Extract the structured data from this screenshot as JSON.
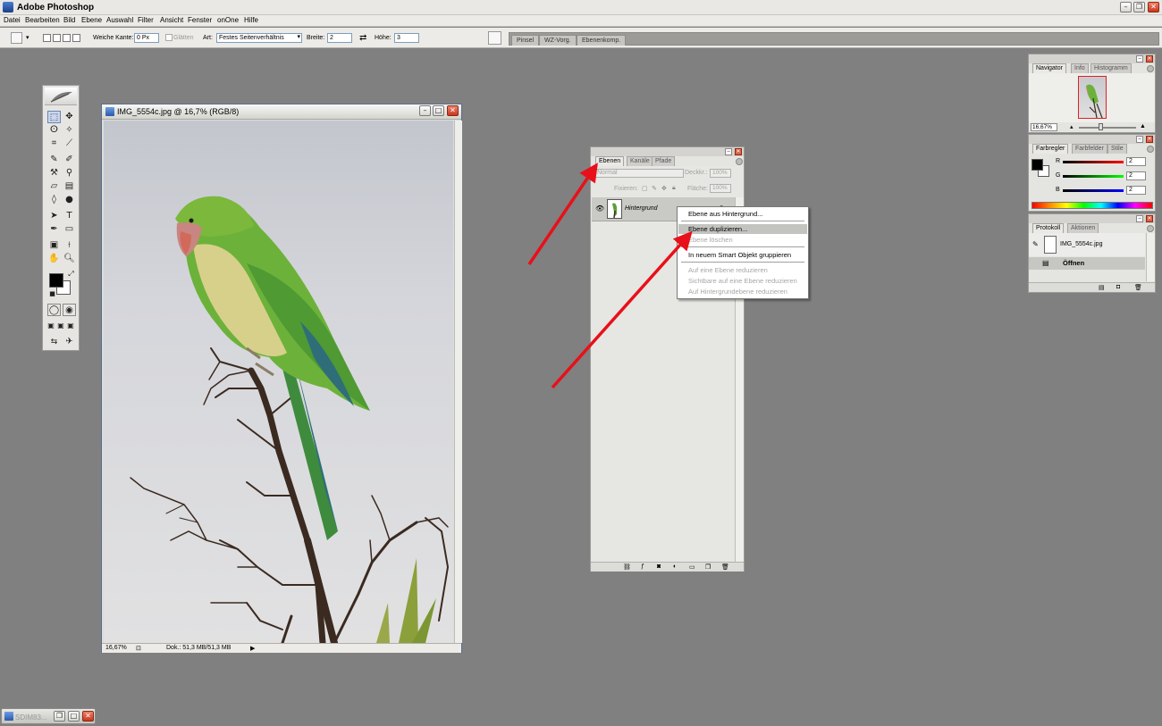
{
  "app": {
    "title": "Adobe Photoshop"
  },
  "menu": [
    "Datei",
    "Bearbeiten",
    "Bild",
    "Ebene",
    "Auswahl",
    "Filter",
    "Ansicht",
    "Fenster",
    "onOne",
    "Hilfe"
  ],
  "options": {
    "weiche_kante_label": "Weiche Kante:",
    "weiche_kante_value": "0 Px",
    "glaetten_label": "Glätten",
    "art_label": "Art:",
    "art_value": "Festes Seitenverhältnis",
    "breite_label": "Breite:",
    "breite_value": "2",
    "hoehe_label": "Höhe:",
    "hoehe_value": "3"
  },
  "well_tabs": [
    "Pinsel",
    "WZ-Vorg.",
    "Ebenenkomp."
  ],
  "document": {
    "title": "IMG_5554c.jpg @ 16,7% (RGB/8)",
    "zoom": "16,67%",
    "doc_size": "Dok.: 51,3 MB/51,3 MB"
  },
  "layers_palette": {
    "tabs": [
      "Ebenen",
      "Kanäle",
      "Pfade"
    ],
    "blend_mode": "Normal",
    "opacity_label": "Deckkr.:",
    "opacity_value": "100%",
    "lock_label": "Fixieren:",
    "fill_label": "Fläche:",
    "fill_value": "100%",
    "layer_name": "Hintergrund"
  },
  "context_menu": {
    "items": [
      {
        "label": "Ebene aus Hintergrund...",
        "enabled": true
      },
      {
        "label": "Ebene duplizieren...",
        "enabled": true,
        "highlighted": true
      },
      {
        "label": "Ebene löschen",
        "enabled": false
      },
      {
        "label": "In neuem Smart Objekt gruppieren",
        "enabled": true
      },
      {
        "label": "Auf eine Ebene reduzieren",
        "enabled": false
      },
      {
        "label": "Sichtbare auf eine Ebene reduzieren",
        "enabled": false
      },
      {
        "label": "Auf Hintergrundebene reduzieren",
        "enabled": false
      }
    ]
  },
  "navigator_palette": {
    "tabs": [
      "Navigator",
      "Info",
      "Histogramm"
    ],
    "zoom": "16,67%"
  },
  "color_palette": {
    "tabs": [
      "Farbregler",
      "Farbfelder",
      "Stile"
    ],
    "r_label": "R",
    "r_value": "2",
    "g_label": "G",
    "g_value": "2",
    "b_label": "B",
    "b_value": "2"
  },
  "history_palette": {
    "tabs": [
      "Protokoll",
      "Aktionen"
    ],
    "snapshot": "IMG_5554c.jpg",
    "state": "Öffnen"
  },
  "minimized_window": {
    "title": "SDIM83..."
  },
  "colors": {
    "workspace": "#808080",
    "annotation_arrow": "#e8101a",
    "menu_highlight": "#c3c3bf"
  }
}
